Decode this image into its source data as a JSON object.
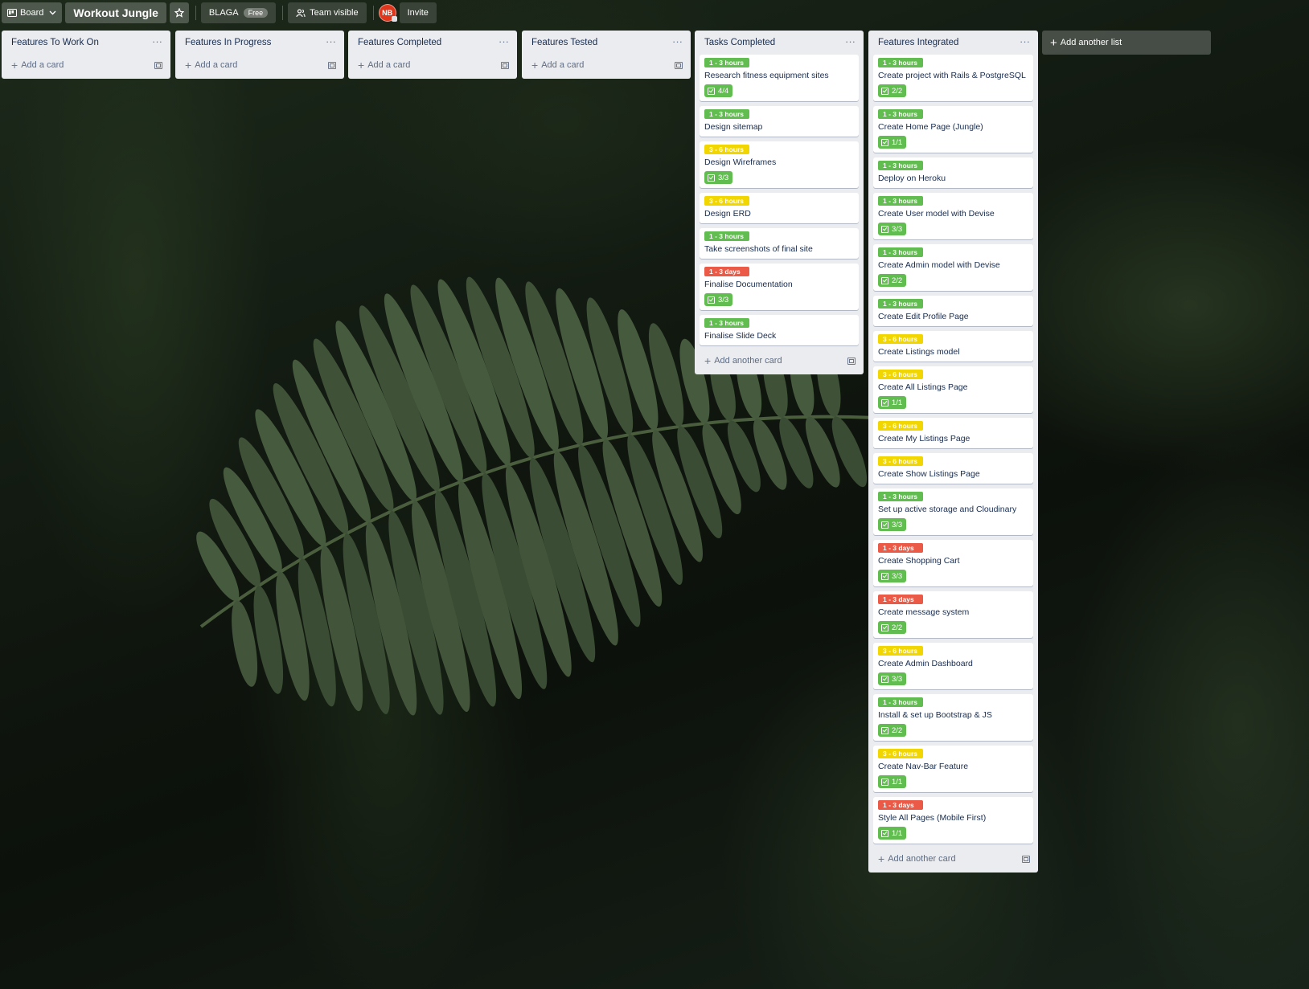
{
  "topbar": {
    "board_menu": "Board",
    "board_title": "Workout Jungle",
    "workspace": "BLAGA",
    "workspace_plan": "Free",
    "visibility": "Team visible",
    "avatar_initials": "NB",
    "invite": "Invite"
  },
  "lists": [
    {
      "title": "Features To Work On",
      "add_card": "Add a card",
      "cards": []
    },
    {
      "title": "Features In Progress",
      "add_card": "Add a card",
      "cards": []
    },
    {
      "title": "Features Completed",
      "add_card": "Add a card",
      "cards": []
    },
    {
      "title": "Features Tested",
      "add_card": "Add a card",
      "cards": []
    },
    {
      "title": "Tasks Completed",
      "add_card": "Add another card",
      "cards": [
        {
          "label": "1 - 3 hours",
          "color": "green",
          "title": "Research fitness equipment sites",
          "checklist": "4/4"
        },
        {
          "label": "1 - 3 hours",
          "color": "green",
          "title": "Design sitemap",
          "checklist": ""
        },
        {
          "label": "3 - 6 hours",
          "color": "yellow",
          "title": "Design Wireframes",
          "checklist": "3/3"
        },
        {
          "label": "3 - 6 hours",
          "color": "yellow",
          "title": "Design ERD",
          "checklist": ""
        },
        {
          "label": "1 - 3 hours",
          "color": "green",
          "title": "Take screenshots of final site",
          "checklist": ""
        },
        {
          "label": "1 - 3 days",
          "color": "red",
          "title": "Finalise Documentation",
          "checklist": "3/3"
        },
        {
          "label": "1 - 3 hours",
          "color": "green",
          "title": "Finalise Slide Deck",
          "checklist": ""
        }
      ]
    },
    {
      "title": "Features Integrated",
      "add_card": "Add another card",
      "cards": [
        {
          "label": "1 - 3 hours",
          "color": "green",
          "title": "Create project with Rails & PostgreSQL",
          "checklist": "2/2"
        },
        {
          "label": "1 - 3 hours",
          "color": "green",
          "title": "Create Home Page (Jungle)",
          "checklist": "1/1"
        },
        {
          "label": "1 - 3 hours",
          "color": "green",
          "title": "Deploy on Heroku",
          "checklist": ""
        },
        {
          "label": "1 - 3 hours",
          "color": "green",
          "title": "Create User model with Devise",
          "checklist": "3/3"
        },
        {
          "label": "1 - 3 hours",
          "color": "green",
          "title": "Create Admin model with Devise",
          "checklist": "2/2"
        },
        {
          "label": "1 - 3 hours",
          "color": "green",
          "title": "Create Edit Profile Page",
          "checklist": ""
        },
        {
          "label": "3 - 6 hours",
          "color": "yellow",
          "title": "Create Listings model",
          "checklist": ""
        },
        {
          "label": "3 - 6 hours",
          "color": "yellow",
          "title": "Create All Listings Page",
          "checklist": "1/1"
        },
        {
          "label": "3 - 6 hours",
          "color": "yellow",
          "title": "Create My Listings Page",
          "checklist": ""
        },
        {
          "label": "3 - 6 hours",
          "color": "yellow",
          "title": "Create Show Listings Page",
          "checklist": ""
        },
        {
          "label": "1 - 3 hours",
          "color": "green",
          "title": "Set up active storage and Cloudinary",
          "checklist": "3/3"
        },
        {
          "label": "1 - 3 days",
          "color": "red",
          "title": "Create Shopping Cart",
          "checklist": "3/3"
        },
        {
          "label": "1 - 3 days",
          "color": "red",
          "title": "Create message system",
          "checklist": "2/2"
        },
        {
          "label": "3 - 6 hours",
          "color": "yellow",
          "title": "Create Admin Dashboard",
          "checklist": "3/3"
        },
        {
          "label": "1 - 3 hours",
          "color": "green",
          "title": "Install & set up Bootstrap & JS",
          "checklist": "2/2"
        },
        {
          "label": "3 - 6 hours",
          "color": "yellow",
          "title": "Create Nav-Bar Feature",
          "checklist": "1/1"
        },
        {
          "label": "1 - 3 days",
          "color": "red",
          "title": "Style All Pages (Mobile First)",
          "checklist": "1/1"
        }
      ]
    }
  ],
  "add_list": "Add another list",
  "colors": {
    "green": "#61bd4f",
    "yellow": "#f2d600",
    "red": "#eb5a46",
    "list_bg": "#ebecf0"
  },
  "icons": [
    "board-icon",
    "chevron-down-icon",
    "star-icon",
    "team-icon",
    "ellipsis-icon",
    "plus-icon",
    "template-icon",
    "checklist-icon"
  ]
}
